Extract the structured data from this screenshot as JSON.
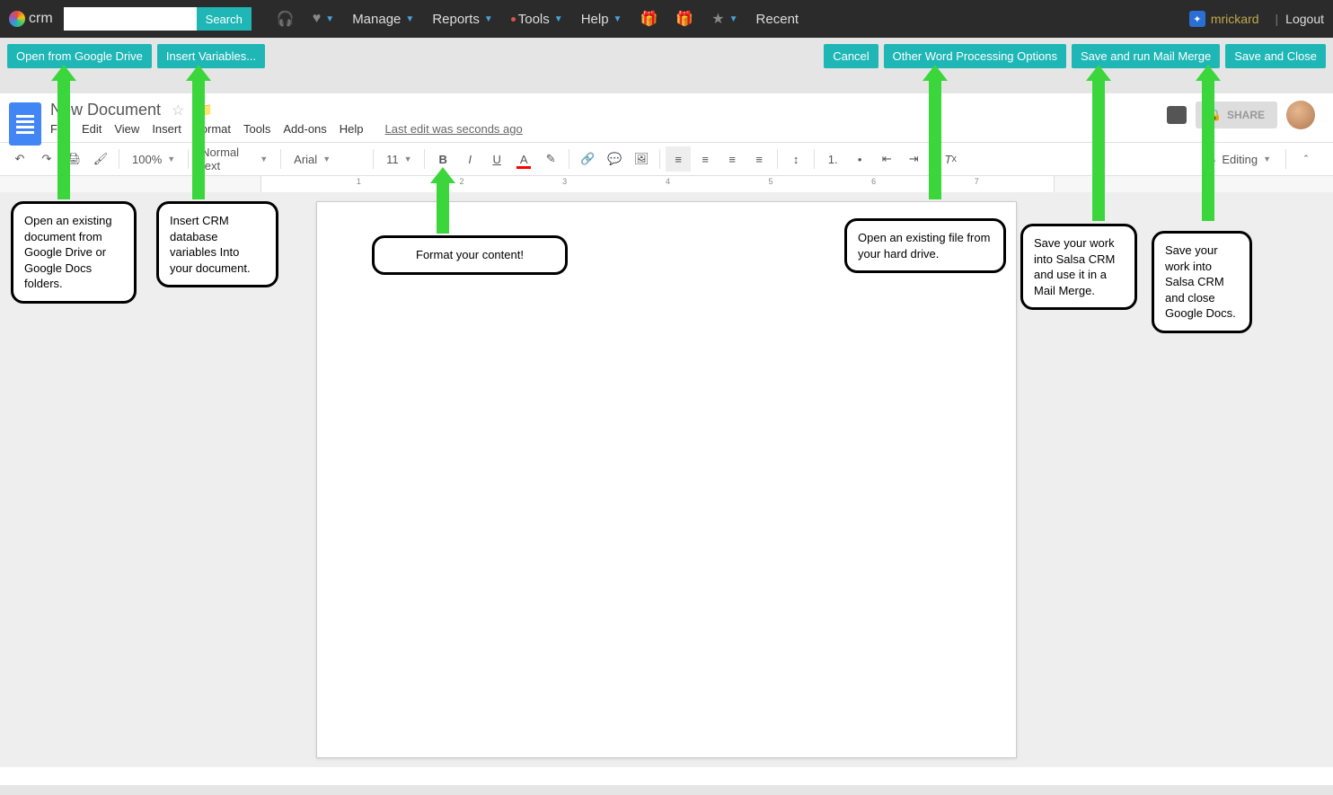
{
  "crm": {
    "logo_text": "crm",
    "search_button": "Search",
    "nav": {
      "manage": "Manage",
      "reports": "Reports",
      "tools": "Tools",
      "help": "Help",
      "recent": "Recent"
    },
    "username": "mrickard",
    "logout": "Logout"
  },
  "actions": {
    "open_gdrive": "Open from Google Drive",
    "insert_vars": "Insert Variables...",
    "cancel": "Cancel",
    "other_wp": "Other Word Processing Options",
    "save_merge": "Save and run Mail Merge",
    "save_close": "Save and Close"
  },
  "docs": {
    "title": "New Document",
    "menus": {
      "file": "File",
      "edit": "Edit",
      "view": "View",
      "insert": "Insert",
      "format": "Format",
      "tools": "Tools",
      "addons": "Add-ons",
      "help": "Help"
    },
    "last_edit": "Last edit was seconds ago",
    "share": "SHARE",
    "zoom": "100%",
    "style": "Normal text",
    "font": "Arial",
    "size": "11",
    "editing": "Editing"
  },
  "ruler": {
    "n1": "1",
    "n2": "2",
    "n3": "3",
    "n4": "4",
    "n5": "5",
    "n6": "6",
    "n7": "7"
  },
  "callouts": {
    "c1": "Open an existing document from Google Drive or Google Docs folders.",
    "c2": "Insert CRM database variables Into your document.",
    "c3": "Format your content!",
    "c4": "Open an existing file from your hard drive.",
    "c5": "Save your work into Salsa CRM and use it in a Mail Merge.",
    "c6": "Save your work into Salsa CRM and close Google Docs."
  }
}
